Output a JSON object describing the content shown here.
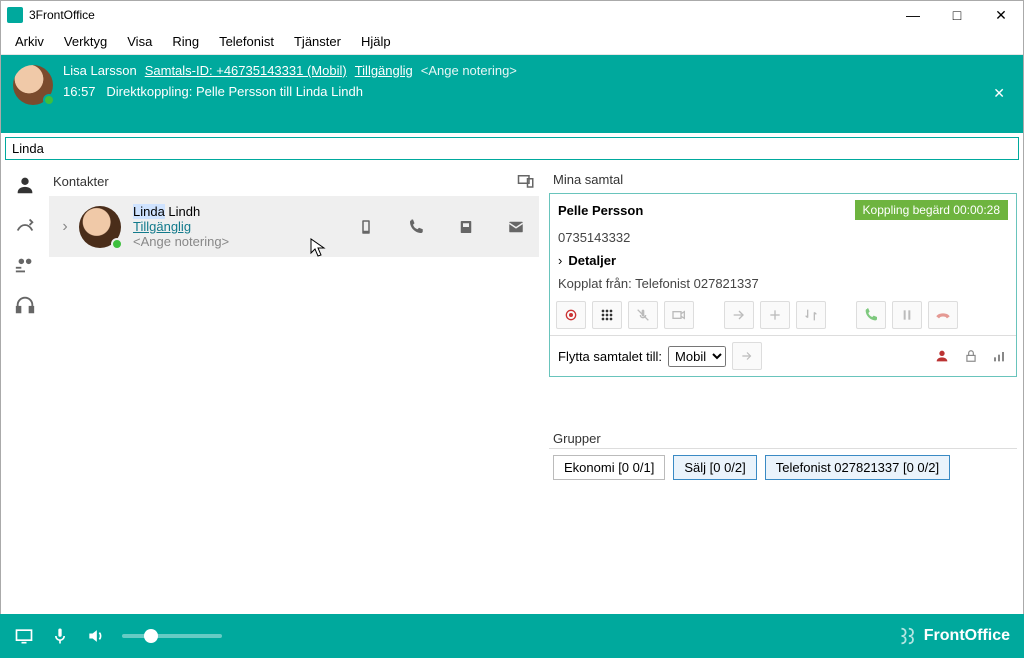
{
  "window": {
    "title": "3FrontOffice"
  },
  "menu": [
    "Arkiv",
    "Verktyg",
    "Visa",
    "Ring",
    "Telefonist",
    "Tjänster",
    "Hjälp"
  ],
  "profile": {
    "name": "Lisa Larsson",
    "call_id": "Samtals-ID: +46735143331 (Mobil)",
    "status": "Tillgänglig",
    "note_placeholder": "<Ange notering>",
    "banner_time": "16:57",
    "banner_text": "Direktkoppling: Pelle Persson till Linda Lindh"
  },
  "search": {
    "value": "Linda"
  },
  "contacts": {
    "header": "Kontakter",
    "item": {
      "first_hl": "Linda",
      "last": " Lindh",
      "status": "Tillgänglig",
      "note": "<Ange notering>"
    }
  },
  "calls": {
    "header": "Mina samtal",
    "caller": "Pelle Persson",
    "badge": "Koppling begärd 00:00:28",
    "number": "0735143332",
    "details": "Detaljer",
    "via": "Kopplat från: Telefonist 027821337",
    "move_label": "Flytta samtalet till:",
    "move_value": "Mobil"
  },
  "groups": {
    "header": "Grupper",
    "items": [
      "Ekonomi [0 0/1]",
      "Sälj [0 0/2]",
      "Telefonist 027821337 [0 0/2]"
    ]
  },
  "brand": "FrontOffice"
}
